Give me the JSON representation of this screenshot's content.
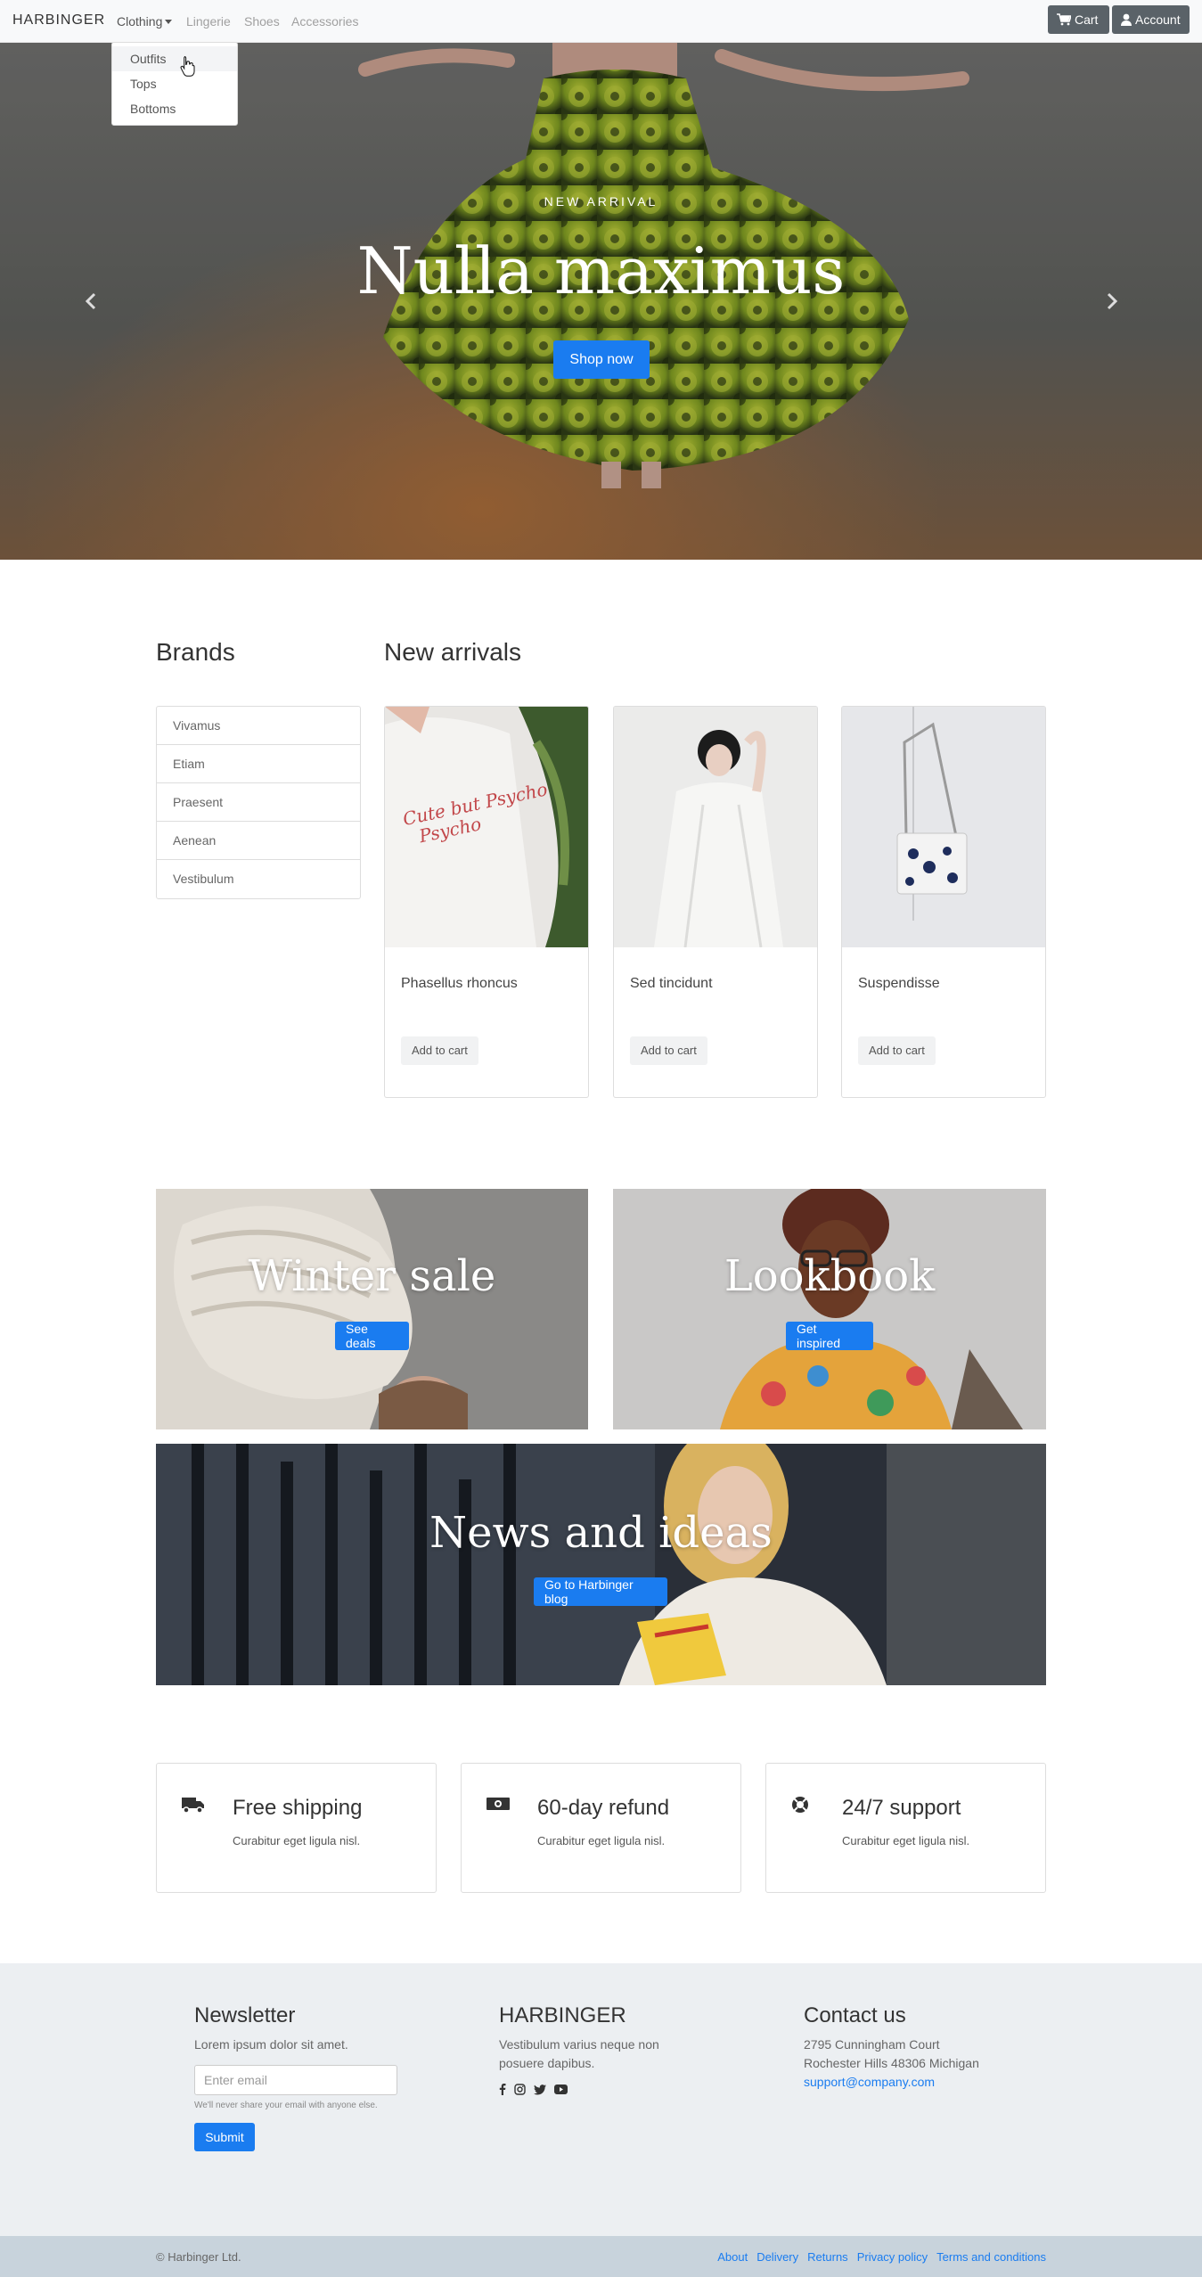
{
  "navbar": {
    "brand": "HARBINGER",
    "links": [
      "Clothing",
      "Lingerie",
      "Shoes",
      "Accessories"
    ],
    "cart_label": "Cart",
    "account_label": "Account",
    "dropdown_items": [
      "Outfits",
      "Tops",
      "Bottoms"
    ]
  },
  "hero": {
    "eyebrow": "NEW ARRIVAL",
    "title": "Nulla maximus",
    "button": "Shop now"
  },
  "brands": {
    "heading": "Brands",
    "items": [
      "Vivamus",
      "Etiam",
      "Praesent",
      "Aenean",
      "Vestibulum"
    ]
  },
  "arrivals": {
    "heading": "New arrivals",
    "products": [
      {
        "name": "Phasellus rhoncus",
        "button": "Add to cart",
        "print": "Cute but Psycho"
      },
      {
        "name": "Sed tincidunt",
        "button": "Add to cart"
      },
      {
        "name": "Suspendisse",
        "button": "Add to cart"
      }
    ]
  },
  "promos": [
    {
      "title": "Winter sale",
      "button": "See deals"
    },
    {
      "title": "Lookbook",
      "button": "Get inspired"
    },
    {
      "title": "News and ideas",
      "button": "Go to Harbinger blog"
    }
  ],
  "features": [
    {
      "icon": "truck-icon",
      "title": "Free shipping",
      "text": "Curabitur eget ligula nisl."
    },
    {
      "icon": "money-icon",
      "title": "60-day refund",
      "text": "Curabitur eget ligula nisl."
    },
    {
      "icon": "lifebuoy-icon",
      "title": "24/7 support",
      "text": "Curabitur eget ligula nisl."
    }
  ],
  "footer": {
    "newsletter": {
      "heading": "Newsletter",
      "text": "Lorem ipsum dolor sit amet.",
      "placeholder": "Enter email",
      "help": "We'll never share your email with anyone else.",
      "submit": "Submit"
    },
    "about": {
      "heading": "HARBINGER",
      "text_line1": "Vestibulum varius neque non",
      "text_line2": "posuere dapibus.",
      "social": [
        "facebook-icon",
        "instagram-icon",
        "twitter-icon",
        "youtube-icon"
      ]
    },
    "contact": {
      "heading": "Contact us",
      "address1": "2795 Cunningham Court",
      "address2": "Rochester Hills 48306 Michigan",
      "email": "support@company.com"
    }
  },
  "bottom": {
    "copyright": "© Harbinger Ltd.",
    "links": [
      "About",
      "Delivery",
      "Returns",
      "Privacy policy",
      "Terms and conditions"
    ]
  },
  "colors": {
    "accent": "#1a7cf0",
    "navbar_bg": "#f8f9fa",
    "footer_bg": "#eceff2",
    "bottom_bar_bg": "#c8d3dc",
    "nav_button_bg": "#5a6268"
  }
}
